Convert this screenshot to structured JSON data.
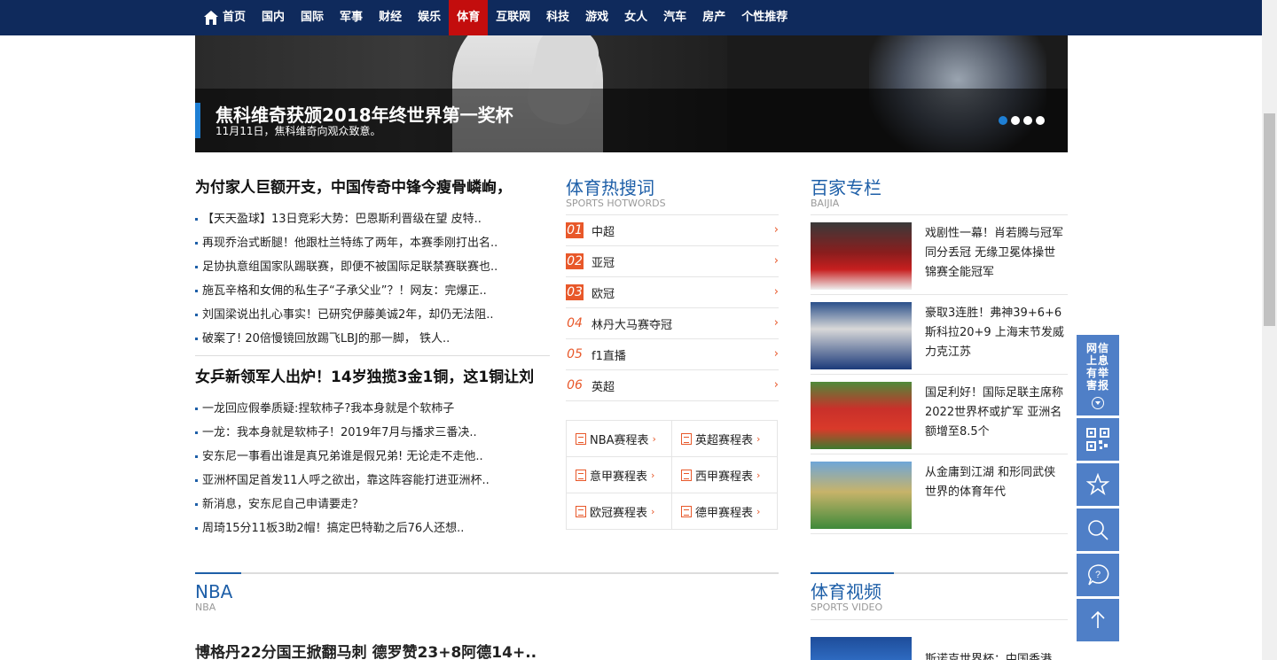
{
  "nav": {
    "items": [
      "首页",
      "国内",
      "国际",
      "军事",
      "财经",
      "娱乐",
      "体育",
      "互联网",
      "科技",
      "游戏",
      "女人",
      "汽车",
      "房产",
      "个性推荐"
    ],
    "active": "体育"
  },
  "hero": {
    "title": "焦科维奇获颁2018年终世界第一奖杯",
    "subtitle": "11月11日，焦科维奇向观众致意。",
    "slides": 4,
    "current_slide": 1
  },
  "news_blocks": [
    {
      "headline": "为付家人巨额开支，中国传奇中锋今瘦骨嶙峋，",
      "items": [
        "【天天盈球】13日竞彩大势：巴恩斯利晋级在望 皮特..",
        "再现乔治式断腿！他跟杜兰特练了两年，本赛季刚打出名..",
        "足协执意组国家队踢联赛，即便不被国际足联禁赛联赛也..",
        "施瓦辛格和女佣的私生子“子承父业”？！网友：完爆正..",
        "刘国梁说出扎心事实！已研究伊藤美诚2年，却仍无法阻..",
        "破案了! 20倍慢镜回放踢飞LBJ的那一脚， 铁人.."
      ]
    },
    {
      "headline": "女乒新领军人出炉！14岁独揽3金1铜，这1铜让刘",
      "items": [
        "一龙回应假拳质疑:捏软柿子?我本身就是个软柿子",
        "一龙：我本身就是软柿子！2019年7月与播求三番决..",
        "安东尼一事看出谁是真兄弟谁是假兄弟! 无论走不走他..",
        "亚洲杯国足首发11人呼之欲出，靠这阵容能打进亚洲杯..",
        "新消息，安东尼自己申请要走？",
        "周琦15分11板3助2帽！搞定巴特勒之后76人还想.."
      ]
    }
  ],
  "hotwords": {
    "title": "体育热搜词",
    "subtitle": "SPORTS HOTWORDS",
    "items": [
      {
        "num": "01",
        "text": "中超",
        "chev": "›"
      },
      {
        "num": "02",
        "text": "亚冠",
        "chev": "›"
      },
      {
        "num": "03",
        "text": "欧冠",
        "chev": "›"
      },
      {
        "num": "04",
        "text": "林丹大马赛夺冠",
        "chev": "›"
      },
      {
        "num": "05",
        "text": "f1直播",
        "chev": "›"
      },
      {
        "num": "06",
        "text": "英超",
        "chev": "›"
      }
    ]
  },
  "schedules": [
    {
      "label": "NBA赛程表",
      "chev": "›"
    },
    {
      "label": "英超赛程表",
      "chev": "›"
    },
    {
      "label": "意甲赛程表",
      "chev": "›"
    },
    {
      "label": "西甲赛程表",
      "chev": "›"
    },
    {
      "label": "欧冠赛程表",
      "chev": "›"
    },
    {
      "label": "德甲赛程表",
      "chev": "›"
    }
  ],
  "baijia": {
    "title": "百家专栏",
    "subtitle": "BAIJIA",
    "items": [
      "戏剧性一幕！肖若腾与冠军同分丢冠 无缘卫冕体操世锦赛全能冠军",
      "豪取3连胜！弗神39+6+6斯科拉20+9 上海末节发威力克江苏",
      "国足利好！国际足联主席称2022世界杯或扩军 亚洲名额增至8.5个",
      "从金庸到江湖 和形同武侠世界的体育年代"
    ]
  },
  "nba": {
    "title": "NBA",
    "subtitle": "NBA",
    "headline": "博格丹22分国王掀翻马刺 德罗赞23+8阿德14+.."
  },
  "video": {
    "title": "体育视频",
    "subtitle": "SPORTS VIDEO",
    "first_item": "斯诺克世界杯：中国香港"
  },
  "tools": {
    "report_label": "网信上息有举害报"
  }
}
